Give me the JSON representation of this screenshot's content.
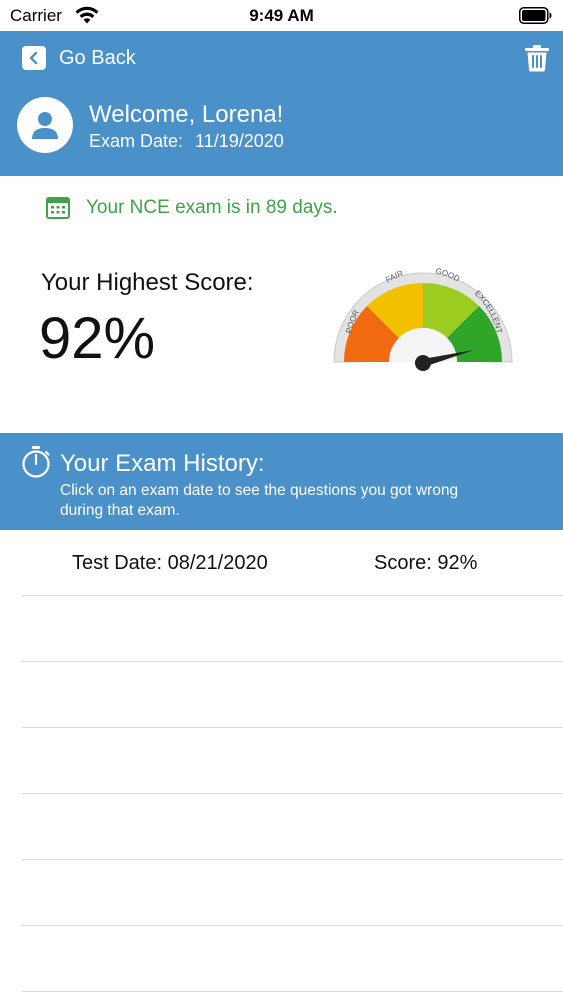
{
  "status_bar": {
    "carrier": "Carrier",
    "time": "9:49 AM"
  },
  "header": {
    "back_label": "Go Back",
    "welcome": "Welcome, Lorena!",
    "exam_date_label": "Exam Date:",
    "exam_date_value": "11/19/2020",
    "background_color": "#4a90c9"
  },
  "countdown": {
    "text": "Your NCE exam is in 89 days.",
    "color": "#43a047"
  },
  "score": {
    "label": "Your Highest Score:",
    "value": "92%",
    "gauge_fraction": 0.92,
    "gauge_labels": [
      "POOR",
      "FAIR",
      "GOOD",
      "EXCELLENT"
    ]
  },
  "history": {
    "title": "Your Exam History:",
    "subtitle": "Click on an exam date to see the questions you got wrong during that exam.",
    "rows": [
      {
        "date": "Test Date: 08/21/2020",
        "score": "Score: 92%"
      },
      {
        "date": "",
        "score": ""
      },
      {
        "date": "",
        "score": ""
      },
      {
        "date": "",
        "score": ""
      },
      {
        "date": "",
        "score": ""
      },
      {
        "date": "",
        "score": ""
      },
      {
        "date": "",
        "score": ""
      }
    ]
  },
  "icons": {
    "wifi": "wifi-icon",
    "battery": "battery-icon",
    "back": "chevron-left-icon",
    "trash": "trash-icon",
    "avatar": "user-icon",
    "calendar": "calendar-icon",
    "stopwatch": "stopwatch-icon"
  }
}
